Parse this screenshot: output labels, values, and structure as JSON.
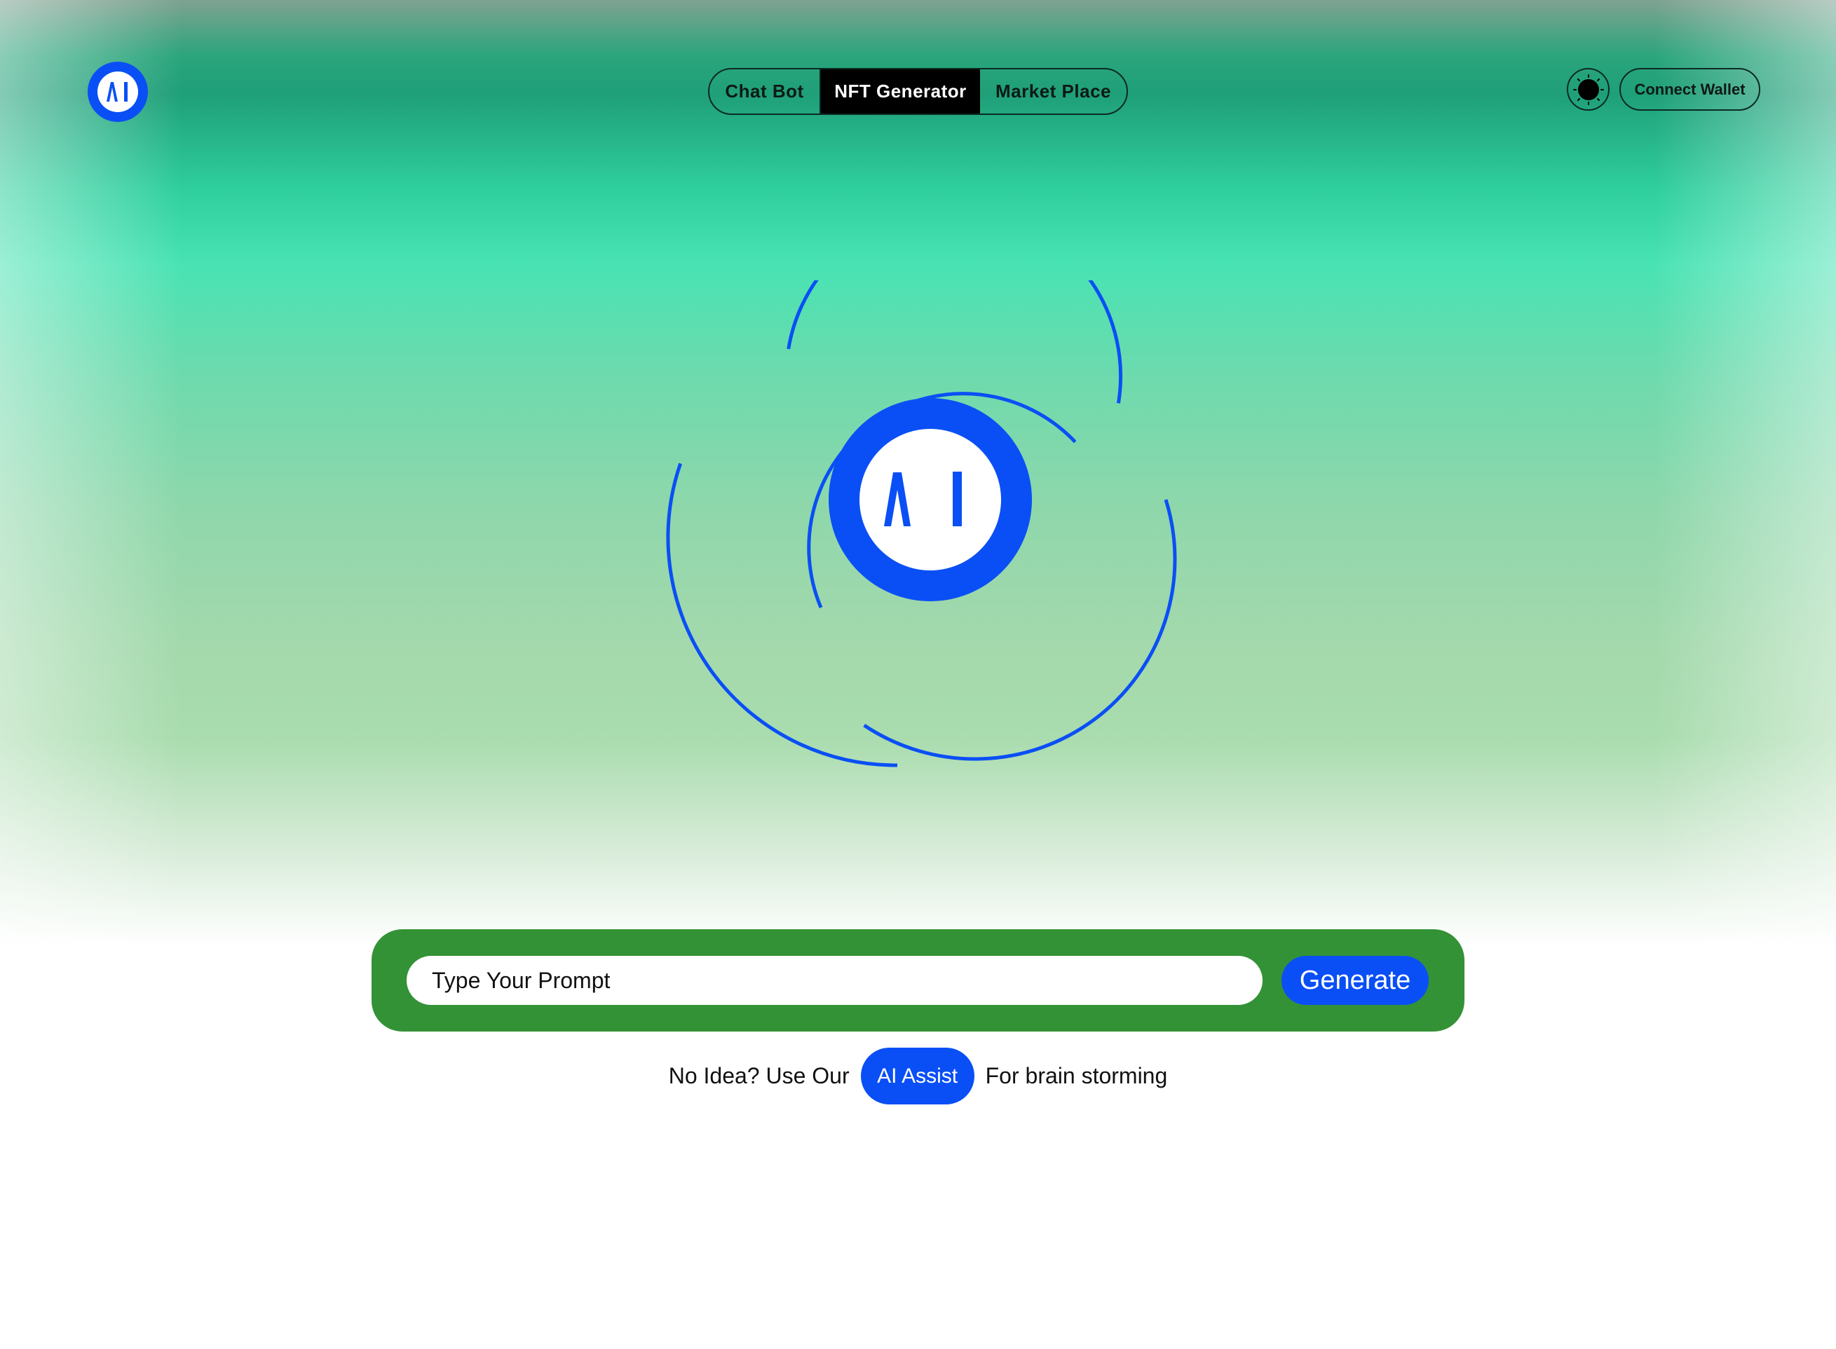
{
  "nav": {
    "tabs": [
      {
        "label": "Chat Bot",
        "active": false
      },
      {
        "label": "NFT Generator",
        "active": true
      },
      {
        "label": "Market Place",
        "active": false
      }
    ]
  },
  "header": {
    "logo_icon": "ai-logo-icon",
    "theme_icon": "sun-icon",
    "connect_wallet_label": "Connect Wallet"
  },
  "prompt": {
    "placeholder": "Type Your Prompt",
    "value": "",
    "generate_label": "Generate"
  },
  "assist": {
    "prefix": "No Idea? Use Our",
    "button_label": "AI Assist",
    "suffix": "For brain storming"
  },
  "colors": {
    "accent_blue": "#0A4FF5",
    "prompt_bar_green": "#339236",
    "active_tab_bg": "#000000"
  }
}
